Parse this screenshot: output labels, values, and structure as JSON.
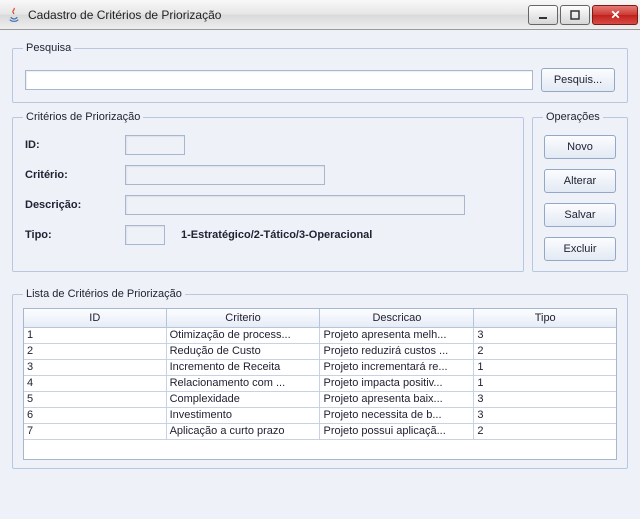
{
  "window": {
    "title": "Cadastro de Critérios de Priorização"
  },
  "search": {
    "legend": "Pesquisa",
    "value": "",
    "button_label": "Pesquis..."
  },
  "criteria": {
    "legend": "Critérios de Priorização",
    "labels": {
      "id": "ID:",
      "criterio": "Critério:",
      "descricao": "Descrição:",
      "tipo": "Tipo:"
    },
    "values": {
      "id": "",
      "criterio": "",
      "descricao": "",
      "tipo": ""
    },
    "tipo_help": "1-Estratégico/2-Tático/3-Operacional"
  },
  "operations": {
    "legend": "Operações",
    "novo": "Novo",
    "alterar": "Alterar",
    "salvar": "Salvar",
    "excluir": "Excluir"
  },
  "list": {
    "legend": "Lista de Critérios de Priorização",
    "columns": {
      "id": "ID",
      "criterio": "Criterio",
      "descricao": "Descricao",
      "tipo": "Tipo"
    },
    "rows": [
      {
        "id": "1",
        "criterio": "Otimização de process...",
        "descricao": "Projeto apresenta melh...",
        "tipo": "3"
      },
      {
        "id": "2",
        "criterio": "Redução de Custo",
        "descricao": "Projeto reduzirá custos ...",
        "tipo": "2"
      },
      {
        "id": "3",
        "criterio": "Incremento de Receita",
        "descricao": "Projeto incrementará re...",
        "tipo": "1"
      },
      {
        "id": "4",
        "criterio": "Relacionamento com ...",
        "descricao": "Projeto impacta positiv...",
        "tipo": "1"
      },
      {
        "id": "5",
        "criterio": "Complexidade",
        "descricao": "Projeto apresenta baix...",
        "tipo": "3"
      },
      {
        "id": "6",
        "criterio": "Investimento",
        "descricao": "Projeto necessita de b...",
        "tipo": "3"
      },
      {
        "id": "7",
        "criterio": "Aplicação a curto prazo",
        "descricao": "Projeto possui aplicaçã...",
        "tipo": "2"
      }
    ]
  }
}
